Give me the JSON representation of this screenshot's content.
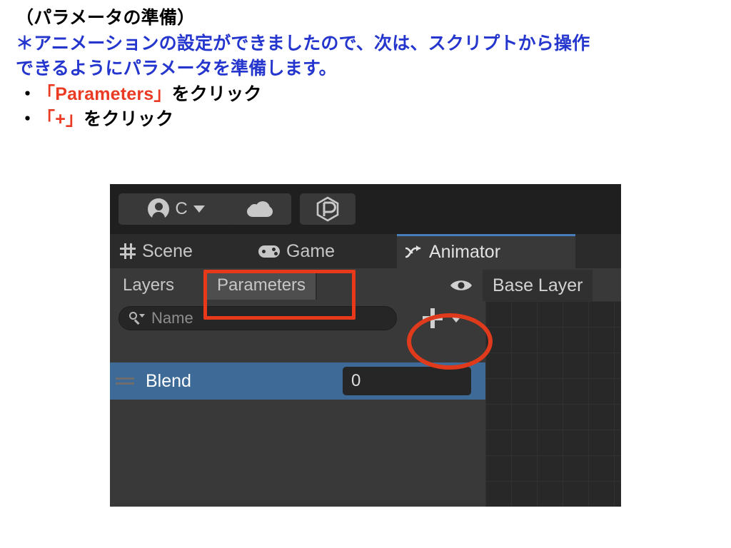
{
  "slide": {
    "heading": "（パラメータの準備）",
    "body_line1": "＊アニメーションの設定ができましたので、次は、スクリプトから操作",
    "body_line2": "できるようにパラメータを準備します。",
    "bullet_marker": "・",
    "bullet1_highlight": "「Parameters」",
    "bullet1_rest": "をクリック",
    "bullet2_highlight": "「+」",
    "bullet2_rest": "をクリック",
    "colors": {
      "heading": "#000000",
      "body": "#2436ce",
      "highlight": "#ea3a23",
      "bullet_text": "#000000"
    }
  },
  "unity": {
    "top_toolbar": {
      "account_button": {
        "icon": "account-avatar-icon",
        "label": "C",
        "dropdown_icon": "chevron-down-icon"
      },
      "cloud_button": {
        "icon": "cloud-icon"
      },
      "package_button": {
        "icon": "unity-package-hex-icon"
      }
    },
    "tabs": [
      {
        "label": "Scene",
        "icon": "grid-hash-icon",
        "active": false
      },
      {
        "label": "Game",
        "icon": "gamepad-icon",
        "active": false
      },
      {
        "label": "Animator",
        "icon": "animator-arrow-icon",
        "active": true
      }
    ],
    "subtabs": [
      {
        "label": "Layers",
        "active": false
      },
      {
        "label": "Parameters",
        "active": true
      }
    ],
    "layer_header": {
      "visibility_icon": "eye-icon",
      "layer_name": "Base Layer"
    },
    "search": {
      "icon": "search-icon",
      "placeholder": "Name",
      "value": ""
    },
    "add_button": {
      "label": "+",
      "icon": "plus-icon",
      "dropdown_icon": "chevron-down-icon"
    },
    "parameters": [
      {
        "name": "Blend",
        "value": "0",
        "selected": true
      }
    ],
    "colors": {
      "panel_bg": "#383838",
      "toolbar_bg": "#1f1f1f",
      "tabbar_bg": "#2b2b2b",
      "active_tab_accent": "#4a7ebb",
      "selected_row": "#3d6a97",
      "canvas_bg": "#282828"
    }
  },
  "annotations": {
    "parameters_box_color": "#e8391a",
    "plus_ellipse_color": "#e03a1c"
  }
}
